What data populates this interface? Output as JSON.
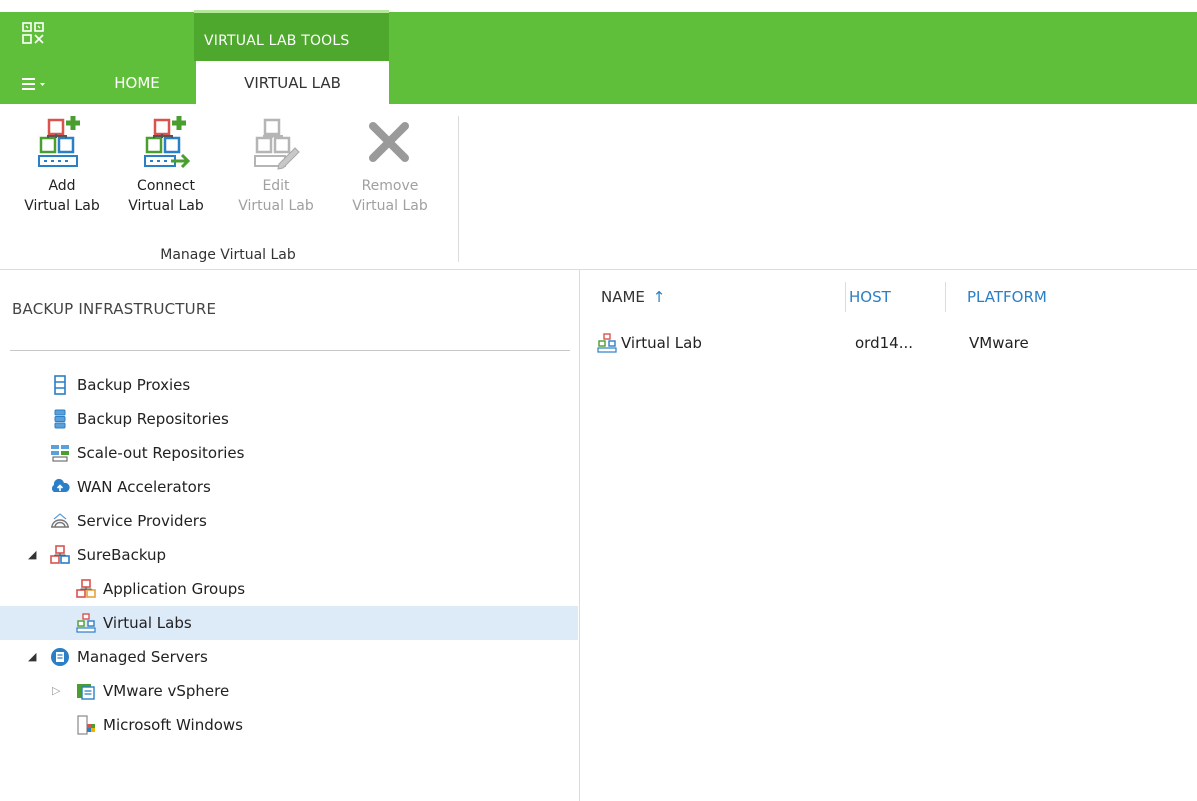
{
  "window": {
    "context_group_label": "VIRTUAL LAB TOOLS",
    "tabs": [
      {
        "label": "HOME",
        "active": false
      },
      {
        "label": "VIRTUAL LAB",
        "active": true
      }
    ],
    "accent_color": "#5fbf3b"
  },
  "ribbon": {
    "buttons": [
      {
        "line1": "Add",
        "line2": "Virtual Lab",
        "icon": "add-virtual-lab-icon",
        "enabled": true
      },
      {
        "line1": "Connect",
        "line2": "Virtual Lab",
        "icon": "connect-virtual-lab-icon",
        "enabled": true
      },
      {
        "line1": "Edit",
        "line2": "Virtual Lab",
        "icon": "edit-virtual-lab-icon",
        "enabled": false
      },
      {
        "line1": "Remove",
        "line2": "Virtual Lab",
        "icon": "remove-icon",
        "enabled": false
      }
    ],
    "group_label": "Manage Virtual Lab"
  },
  "nav": {
    "title": "BACKUP INFRASTRUCTURE",
    "items": [
      {
        "label": "Backup Proxies",
        "icon": "server-icon"
      },
      {
        "label": "Backup Repositories",
        "icon": "database-icon"
      },
      {
        "label": "Scale-out Repositories",
        "icon": "scale-out-repository-icon"
      },
      {
        "label": "WAN Accelerators",
        "icon": "cloud-upload-icon"
      },
      {
        "label": "Service Providers",
        "icon": "service-provider-icon"
      },
      {
        "label": "SureBackup",
        "icon": "surebackup-icon",
        "expanded": true
      },
      {
        "label": "Application Groups",
        "icon": "application-group-icon"
      },
      {
        "label": "Virtual Labs",
        "icon": "virtual-lab-icon",
        "selected": true
      },
      {
        "label": "Managed Servers",
        "icon": "managed-servers-icon",
        "expanded": true
      },
      {
        "label": "VMware vSphere",
        "icon": "vmware-vsphere-icon",
        "expanded": false
      },
      {
        "label": "Microsoft Windows",
        "icon": "windows-icon"
      }
    ]
  },
  "list": {
    "columns": {
      "name": "NAME",
      "host": "HOST",
      "platform": "PLATFORM"
    },
    "sort_indicator": "↑",
    "rows": [
      {
        "name": "Virtual Lab",
        "host": "ord14...",
        "platform": "VMware"
      }
    ]
  }
}
